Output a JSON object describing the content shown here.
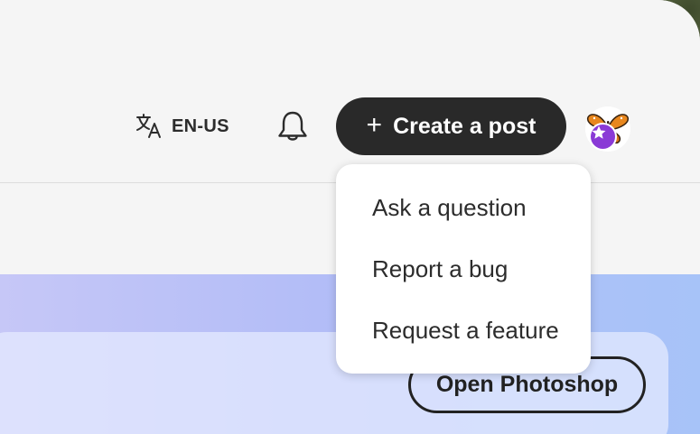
{
  "header": {
    "language": {
      "label": "EN-US",
      "icon": "translate-icon"
    },
    "notifications": {
      "icon": "bell-icon"
    },
    "create_post": {
      "icon": "plus-icon",
      "plus_glyph": "+",
      "label": "Create a post"
    },
    "avatar": {
      "icon": "butterfly-avatar",
      "badge_icon": "star-icon",
      "badge_color": "#8a3ad6"
    }
  },
  "create_menu": {
    "items": [
      {
        "label": "Ask a question"
      },
      {
        "label": "Report a bug"
      },
      {
        "label": "Request a feature"
      }
    ]
  },
  "banner": {
    "open_button_label": "Open Photoshop"
  },
  "colors": {
    "primary_button": "#292929",
    "background": "#f5f5f5",
    "banner_gradient_start": "#c6c7f7",
    "banner_gradient_end": "#a7c3f8"
  }
}
